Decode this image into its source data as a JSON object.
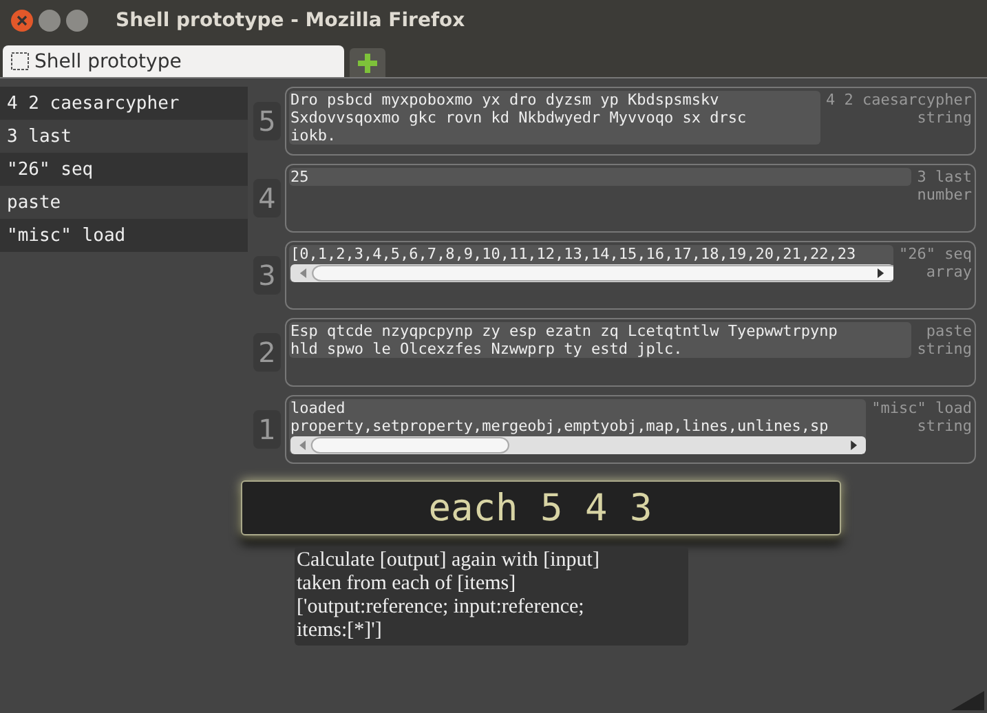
{
  "window": {
    "title": "Shell prototype - Mozilla Firefox"
  },
  "tabs": [
    {
      "label": "Shell prototype",
      "selected": true
    }
  ],
  "stack": [
    {
      "label": "4 2 caesarcypher"
    },
    {
      "label": "3 last"
    },
    {
      "label": "\"26\" seq"
    },
    {
      "label": "paste"
    },
    {
      "label": "\"misc\" load"
    }
  ],
  "cells": [
    {
      "number": "5",
      "kind": "wrap",
      "lines": [
        "Dro psbcd myxpoboxmo yx dro dyzsm yp Kbdspsmskv",
        "Sxdovvsqoxmo gkc rovn kd Nkbdwyedr Myvvoqo sx drsc",
        "iokb."
      ],
      "source": "4 2 caesarcypher",
      "type": "string"
    },
    {
      "number": "4",
      "kind": "wrap",
      "lines": [
        "25"
      ],
      "source": "3 last",
      "type": "number"
    },
    {
      "number": "3",
      "kind": "scroll",
      "lines": [
        "[0,1,2,3,4,5,6,7,8,9,10,11,12,13,14,15,16,17,18,19,20,21,22,23"
      ],
      "source": "\"26\" seq",
      "type": "array"
    },
    {
      "number": "2",
      "kind": "wrap",
      "lines": [
        "Esp qtcde nzyqpcpynp zy esp ezatn zq Lcetqtntlw Tyepwwtrpynp",
        "hld spwo le Olcexzfes Nzwwprp ty estd jplc."
      ],
      "source": "paste",
      "type": "string"
    },
    {
      "number": "1",
      "kind": "scroll",
      "lines": [
        "loaded",
        "property,setproperty,mergeobj,emptyobj,map,lines,unlines,sp"
      ],
      "source": "\"misc\" load",
      "type": "string"
    }
  ],
  "command": {
    "value": "each 5 4 3"
  },
  "tooltip": {
    "lines": [
      "Calculate [output] again with [input]",
      "taken from each of [items]",
      "['output:reference; input:reference;",
      "items:[*]']"
    ]
  }
}
